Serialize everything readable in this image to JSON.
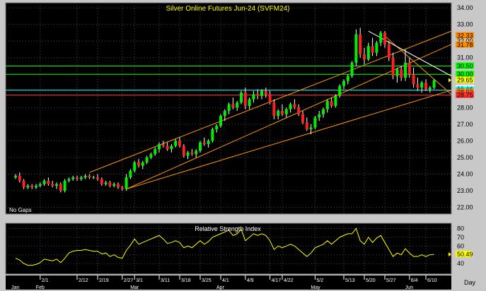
{
  "chart_data": {
    "type": "candlestick",
    "title": "Silver Online Futures Jun-24 (SVFM24)",
    "note": "No Gaps",
    "x_axis_title": "Day",
    "yticks": [
      "22.00",
      "23.00",
      "24.00",
      "25.00",
      "26.00",
      "27.00",
      "28.00",
      "29.00",
      "30.00",
      "31.00",
      "32.00",
      "33.00",
      "34.00"
    ],
    "ylim": [
      21.6,
      34.3
    ],
    "date_ticks": [
      {
        "label": "2/1",
        "i": 6
      },
      {
        "label": "2/12",
        "i": 15
      },
      {
        "label": "2/19",
        "i": 20
      },
      {
        "label": "2/27",
        "i": 26
      },
      {
        "label": "3/1",
        "i": 29
      },
      {
        "label": "3/11",
        "i": 35
      },
      {
        "label": "3/18",
        "i": 40
      },
      {
        "label": "3/25",
        "i": 45
      },
      {
        "label": "4/1",
        "i": 50
      },
      {
        "label": "4/9",
        "i": 56
      },
      {
        "label": "4/17",
        "i": 62
      },
      {
        "label": "4/22",
        "i": 65
      },
      {
        "label": "5/2",
        "i": 73
      },
      {
        "label": "5/13",
        "i": 80
      },
      {
        "label": "5/20",
        "i": 85
      },
      {
        "label": "5/27",
        "i": 90
      },
      {
        "label": "6/4",
        "i": 96
      },
      {
        "label": "6/10",
        "i": 100
      }
    ],
    "month_labels": [
      {
        "label": "Jan",
        "i": 0
      },
      {
        "label": "Feb",
        "i": 6
      },
      {
        "label": "Mar",
        "i": 29
      },
      {
        "label": "Apr",
        "i": 50
      },
      {
        "label": "May",
        "i": 73
      },
      {
        "label": "Jun",
        "i": 96
      }
    ],
    "price_labels": [
      {
        "text": "32.33",
        "value": 32.33,
        "color": "#ff8c00"
      },
      {
        "text": "31.78",
        "value": 31.78,
        "color": "#ff8c00"
      },
      {
        "text": "30.50",
        "value": 30.5,
        "color": "#00ff00"
      },
      {
        "text": "30.00",
        "value": 30.0,
        "color": "#00ff00"
      },
      {
        "text": "29.65",
        "value": 29.65,
        "color": "#ffff00"
      },
      {
        "text": "29.14",
        "value": 29.14,
        "color": "#ffffff"
      },
      {
        "text": "29.05",
        "value": 29.05,
        "color": "#00ffff"
      },
      {
        "text": "28.93",
        "value": 28.93,
        "color": "#ff8c00"
      },
      {
        "text": "28.75",
        "value": 28.75,
        "color": "#ff3030"
      }
    ],
    "hlines": [
      {
        "value": 30.5,
        "color": "#00ff00"
      },
      {
        "value": 30.0,
        "color": "#00ff00"
      },
      {
        "value": 29.05,
        "color": "#00ffff"
      },
      {
        "value": 28.75,
        "color": "#ff4040"
      }
    ],
    "trendlines": [
      {
        "i1": 18,
        "v1": 24.1,
        "i2": 123,
        "v2": 32.6,
        "color": "#ff9900"
      },
      {
        "i1": 27,
        "v1": 23.1,
        "i2": 123,
        "v2": 31.8,
        "color": "#ff9900"
      },
      {
        "i1": 27,
        "v1": 23.1,
        "i2": 123,
        "v2": 29.05,
        "color": "#ff9900"
      },
      {
        "i1": 90,
        "v1": 32.3,
        "i2": 108,
        "v2": 28.8,
        "color": "#ff9900"
      },
      {
        "i1": 86,
        "v1": 32.6,
        "i2": 108,
        "v2": 29.9,
        "color": "#ffffff"
      }
    ],
    "ohlc": [
      [
        23.8,
        24.0,
        23.7,
        23.9
      ],
      [
        23.9,
        24.1,
        23.5,
        23.6
      ],
      [
        23.6,
        23.7,
        23.1,
        23.2
      ],
      [
        23.2,
        23.4,
        23.1,
        23.3
      ],
      [
        23.3,
        23.4,
        23.1,
        23.2
      ],
      [
        23.2,
        23.4,
        23.1,
        23.3
      ],
      [
        23.3,
        23.5,
        23.2,
        23.4
      ],
      [
        23.4,
        23.7,
        23.3,
        23.6
      ],
      [
        23.6,
        23.8,
        23.3,
        23.4
      ],
      [
        23.4,
        23.6,
        23.2,
        23.3
      ],
      [
        23.3,
        23.5,
        23.1,
        23.4
      ],
      [
        23.4,
        23.5,
        22.9,
        23.0
      ],
      [
        23.0,
        23.7,
        22.9,
        23.6
      ],
      [
        23.6,
        23.8,
        23.5,
        23.7
      ],
      [
        23.7,
        23.9,
        23.6,
        23.8
      ],
      [
        23.8,
        23.9,
        23.6,
        23.7
      ],
      [
        23.7,
        23.9,
        23.6,
        23.8
      ],
      [
        23.8,
        24.0,
        23.7,
        23.9
      ],
      [
        23.9,
        24.0,
        23.7,
        23.8
      ],
      [
        23.8,
        23.9,
        23.7,
        23.8
      ],
      [
        23.8,
        24.0,
        23.6,
        23.7
      ],
      [
        23.7,
        23.8,
        23.3,
        23.4
      ],
      [
        23.4,
        23.6,
        23.3,
        23.5
      ],
      [
        23.5,
        23.6,
        23.2,
        23.3
      ],
      [
        23.3,
        23.5,
        23.2,
        23.4
      ],
      [
        23.4,
        23.5,
        23.1,
        23.2
      ],
      [
        23.2,
        23.3,
        23.0,
        23.1
      ],
      [
        23.1,
        24.0,
        23.0,
        23.8
      ],
      [
        23.8,
        24.3,
        23.7,
        24.2
      ],
      [
        24.2,
        24.8,
        24.1,
        24.7
      ],
      [
        24.7,
        24.9,
        24.4,
        24.5
      ],
      [
        24.5,
        24.8,
        24.3,
        24.7
      ],
      [
        24.7,
        25.1,
        24.6,
        25.0
      ],
      [
        25.0,
        25.3,
        24.9,
        25.2
      ],
      [
        25.2,
        25.6,
        25.1,
        25.5
      ],
      [
        25.5,
        25.9,
        25.3,
        25.8
      ],
      [
        25.8,
        26.0,
        25.6,
        25.7
      ],
      [
        25.7,
        25.9,
        25.4,
        25.5
      ],
      [
        25.5,
        25.8,
        25.3,
        25.7
      ],
      [
        25.7,
        26.1,
        25.6,
        26.0
      ],
      [
        26.0,
        26.2,
        25.6,
        25.7
      ],
      [
        25.7,
        25.8,
        25.0,
        25.1
      ],
      [
        25.1,
        25.4,
        24.9,
        25.3
      ],
      [
        25.3,
        25.5,
        25.1,
        25.2
      ],
      [
        25.2,
        25.5,
        25.0,
        25.4
      ],
      [
        25.4,
        26.0,
        25.3,
        25.9
      ],
      [
        25.9,
        26.2,
        25.7,
        25.8
      ],
      [
        25.8,
        26.1,
        25.6,
        26.0
      ],
      [
        26.0,
        26.8,
        25.9,
        26.7
      ],
      [
        26.7,
        27.0,
        26.5,
        26.9
      ],
      [
        26.9,
        27.6,
        26.8,
        27.5
      ],
      [
        27.5,
        27.9,
        27.2,
        27.8
      ],
      [
        27.8,
        28.3,
        27.6,
        28.2
      ],
      [
        28.2,
        28.6,
        27.9,
        28.0
      ],
      [
        28.0,
        28.4,
        27.8,
        28.3
      ],
      [
        28.3,
        29.0,
        28.2,
        28.9
      ],
      [
        28.9,
        29.2,
        27.9,
        28.1
      ],
      [
        28.1,
        28.6,
        27.9,
        28.5
      ],
      [
        28.5,
        29.0,
        28.3,
        28.8
      ],
      [
        28.8,
        29.1,
        28.5,
        28.7
      ],
      [
        28.7,
        29.1,
        28.5,
        29.0
      ],
      [
        29.0,
        29.2,
        28.6,
        28.8
      ],
      [
        28.8,
        29.0,
        28.2,
        28.3
      ],
      [
        28.3,
        28.5,
        27.3,
        27.5
      ],
      [
        27.5,
        27.9,
        27.3,
        27.8
      ],
      [
        27.8,
        28.2,
        27.5,
        27.6
      ],
      [
        27.6,
        28.0,
        27.4,
        27.9
      ],
      [
        27.9,
        28.3,
        27.7,
        28.2
      ],
      [
        28.2,
        28.5,
        27.9,
        28.0
      ],
      [
        28.0,
        28.2,
        27.5,
        27.6
      ],
      [
        27.6,
        27.8,
        27.0,
        27.1
      ],
      [
        27.1,
        27.4,
        26.6,
        26.7
      ],
      [
        26.7,
        27.0,
        26.4,
        26.8
      ],
      [
        26.8,
        27.5,
        26.7,
        27.4
      ],
      [
        27.4,
        27.8,
        27.2,
        27.6
      ],
      [
        27.6,
        28.0,
        27.4,
        27.9
      ],
      [
        27.9,
        28.5,
        27.7,
        28.4
      ],
      [
        28.4,
        28.6,
        28.0,
        28.1
      ],
      [
        28.1,
        28.8,
        28.0,
        28.7
      ],
      [
        28.7,
        29.4,
        28.6,
        29.3
      ],
      [
        29.3,
        29.7,
        29.1,
        29.6
      ],
      [
        29.6,
        30.0,
        29.4,
        29.9
      ],
      [
        29.9,
        30.8,
        29.8,
        30.7
      ],
      [
        30.7,
        32.7,
        30.5,
        32.4
      ],
      [
        32.4,
        32.8,
        31.0,
        31.2
      ],
      [
        31.2,
        31.6,
        30.6,
        30.9
      ],
      [
        30.9,
        31.9,
        30.8,
        31.7
      ],
      [
        31.7,
        32.2,
        31.1,
        31.3
      ],
      [
        31.3,
        32.0,
        31.1,
        31.9
      ],
      [
        31.9,
        32.6,
        31.7,
        32.5
      ],
      [
        32.5,
        32.6,
        31.6,
        31.8
      ],
      [
        31.8,
        32.0,
        30.8,
        31.0
      ],
      [
        31.0,
        31.3,
        29.7,
        29.9
      ],
      [
        29.9,
        30.4,
        29.5,
        30.3
      ],
      [
        30.3,
        30.5,
        29.6,
        29.8
      ],
      [
        29.8,
        31.5,
        29.6,
        30.7
      ],
      [
        30.7,
        31.0,
        29.8,
        30.0
      ],
      [
        30.0,
        30.4,
        29.2,
        29.4
      ],
      [
        29.4,
        29.8,
        29.0,
        29.2
      ],
      [
        29.2,
        29.6,
        28.9,
        29.5
      ],
      [
        29.5,
        29.7,
        29.0,
        29.1
      ],
      [
        29.1,
        29.3,
        28.9,
        29.2
      ],
      [
        29.2,
        29.7,
        29.1,
        29.65
      ]
    ],
    "rsi": {
      "title": "Relative Strength Index",
      "yticks": [
        "40",
        "50",
        "60",
        "70",
        "80"
      ],
      "ylim": [
        28,
        86
      ],
      "last": "50.49",
      "values": [
        46,
        44,
        40,
        38,
        38,
        39,
        41,
        45,
        44,
        43,
        45,
        41,
        46,
        52,
        54,
        55,
        55,
        56,
        55,
        54,
        54,
        51,
        52,
        48,
        50,
        47,
        46,
        55,
        61,
        68,
        62,
        64,
        66,
        68,
        70,
        72,
        68,
        63,
        64,
        66,
        64,
        58,
        60,
        58,
        62,
        66,
        62,
        65,
        70,
        72,
        74,
        76,
        78,
        72,
        74,
        79,
        66,
        70,
        74,
        72,
        74,
        72,
        66,
        56,
        60,
        58,
        60,
        62,
        60,
        56,
        52,
        48,
        52,
        58,
        60,
        62,
        66,
        62,
        66,
        70,
        72,
        74,
        74,
        80,
        66,
        62,
        70,
        64,
        69,
        72,
        64,
        56,
        48,
        52,
        50,
        57,
        52,
        48,
        48,
        50,
        48,
        50,
        50.49
      ]
    }
  }
}
